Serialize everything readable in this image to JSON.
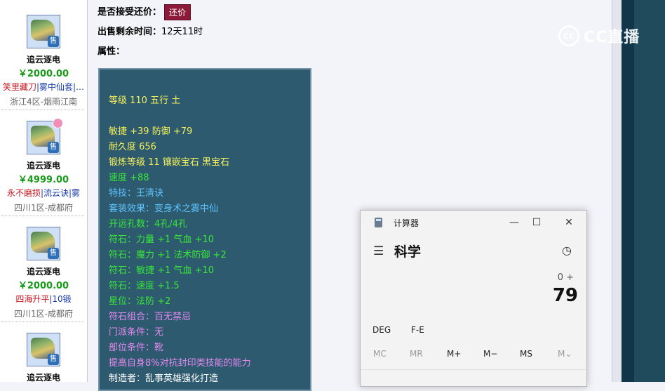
{
  "listing": {
    "items": [
      {
        "name": "追云逐电",
        "price": "￥2000.00",
        "tags": [
          {
            "text": "笑里藏刀",
            "color": "red"
          },
          {
            "text": "|",
            "color": "blue"
          },
          {
            "text": "雾中仙套",
            "color": "blue"
          },
          {
            "text": "|…",
            "color": "blue"
          }
        ],
        "server": "浙江4区-烟雨江南",
        "sell_badge": "售",
        "has_corner_badge": false
      },
      {
        "name": "追云逐电",
        "price": "￥4999.00",
        "tags": [
          {
            "text": "永不磨损",
            "color": "red"
          },
          {
            "text": "|",
            "color": "blue"
          },
          {
            "text": "流云诀",
            "color": "blue"
          },
          {
            "text": "|雾",
            "color": "blue"
          }
        ],
        "server": "四川1区-成都府",
        "sell_badge": "售",
        "has_corner_badge": true
      },
      {
        "name": "追云逐电",
        "price": "￥2000.00",
        "tags": [
          {
            "text": "四海升平",
            "color": "red"
          },
          {
            "text": "|",
            "color": "blue"
          },
          {
            "text": "10锻",
            "color": "blue"
          }
        ],
        "server": "四川1区-成都府",
        "sell_badge": "售",
        "has_corner_badge": false
      },
      {
        "name": "追云逐电",
        "price": "",
        "tags": [],
        "server": "",
        "sell_badge": "售",
        "has_corner_badge": false
      }
    ]
  },
  "detail": {
    "bargain_label": "是否接受还价：",
    "bargain_button": "还价",
    "time_label": "出售剩余时间：",
    "time_value": "12天11时",
    "attr_label": "属性："
  },
  "attributes": [
    {
      "text": "等级 110 五行 土",
      "color": "yellow"
    },
    {
      "text": "敏捷 +39 防御 +79",
      "color": "yellow"
    },
    {
      "text": "耐久度 656",
      "color": "yellow"
    },
    {
      "text": "锻炼等级 11 镶嵌宝石 黑宝石",
      "color": "yellow"
    },
    {
      "text": "速度 +88",
      "color": "green"
    },
    {
      "text": "特技：王清诀",
      "color": "skyblue"
    },
    {
      "text": "套装效果：变身术之雾中仙",
      "color": "skyblue"
    },
    {
      "text": "开运孔数：4孔/4孔",
      "color": "green"
    },
    {
      "text": "符石：力量 +1 气血 +10",
      "color": "green"
    },
    {
      "text": "符石：魔力 +1 法术防御 +2",
      "color": "green"
    },
    {
      "text": "符石：敏捷 +1 气血 +10",
      "color": "green"
    },
    {
      "text": "符石：速度 +1.5",
      "color": "green"
    },
    {
      "text": "星位：法防 +2",
      "color": "green"
    },
    {
      "text": "符石组合：百无禁忌",
      "color": "purple"
    },
    {
      "text": "门派条件：无",
      "color": "purple"
    },
    {
      "text": "部位条件：靴",
      "color": "purple"
    },
    {
      "text": "提高自身8%对抗封印类技能的能力",
      "color": "purple"
    },
    {
      "text": "制造者：乱事英雄强化打造",
      "color": "white"
    }
  ],
  "watermark": {
    "logo": "CC",
    "text": "CC直播"
  },
  "calculator": {
    "title": "计算器",
    "mode": "科学",
    "expression": "0 +",
    "display": "79",
    "function_buttons": [
      "DEG",
      "F-E"
    ],
    "memory_buttons": [
      {
        "label": "MC",
        "enabled": false
      },
      {
        "label": "MR",
        "enabled": false
      },
      {
        "label": "M+",
        "enabled": true
      },
      {
        "label": "M−",
        "enabled": true
      },
      {
        "label": "MS",
        "enabled": true
      },
      {
        "label": "M⌄",
        "enabled": false
      }
    ],
    "icons": {
      "menu": "hamburger-icon",
      "history": "history-icon",
      "minimize": "minimize-icon",
      "maximize": "maximize-icon",
      "close": "close-icon"
    }
  }
}
